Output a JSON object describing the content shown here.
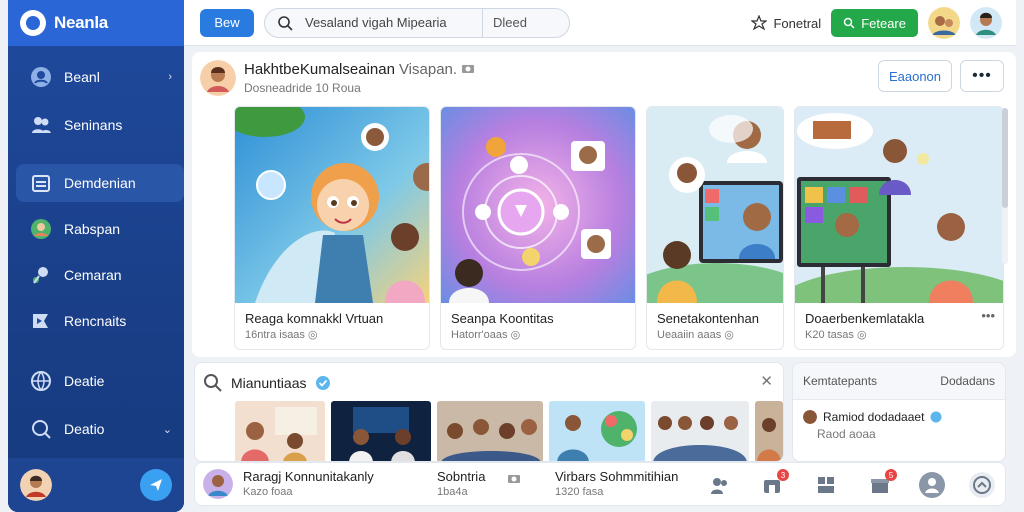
{
  "brand": {
    "name": "Neanla"
  },
  "sidebar": {
    "items": [
      {
        "label": "Beanl",
        "icon": "user-circle-icon",
        "caret": "›"
      },
      {
        "label": "Seninans",
        "icon": "people-icon"
      },
      {
        "label": "Demdenian",
        "icon": "calendar-icon",
        "active": true
      },
      {
        "label": "Rabspan",
        "icon": "avatar-icon"
      },
      {
        "label": "Cemaran",
        "icon": "search-person-icon"
      },
      {
        "label": "Rencnaits",
        "icon": "flag-icon"
      },
      {
        "label": "Deatie",
        "icon": "globe-icon"
      },
      {
        "label": "Deatio",
        "icon": "search-icon",
        "caret": "⌄"
      }
    ]
  },
  "topbar": {
    "new_label": "Bew",
    "search_placeholder": "Vesaland vigah Mipearia",
    "search_filter": "Dleed",
    "favorite_label": "Fonetral",
    "green_button_label": "Feteare"
  },
  "main": {
    "title": "HakhtbeKumalseainan",
    "title_muted": "Visapan.",
    "subtitle": "Dosneadride 10 Roua",
    "outline_button": "Eaaonon",
    "more_button": "•••",
    "cards": [
      {
        "caption": "Reaga komnakkl Vrtuan",
        "meta": "16ntra isaas"
      },
      {
        "caption": "Seanpa Koontitas",
        "meta": "Hatorr'oaas"
      },
      {
        "caption": "Senetakontenhan",
        "meta": "Ueaaiin aaas"
      },
      {
        "caption": "Doaerbenkemlatakla",
        "meta": "K20 tasas",
        "more": "•••"
      }
    ]
  },
  "community": {
    "title": "Mianuntiaas",
    "close": "✕"
  },
  "side_panel": {
    "tabs": [
      "Kemtatepants",
      "Dodadans"
    ],
    "row_title": "Ramiod dodadaaet",
    "row_meta": "Raod aoaa"
  },
  "bottombar": {
    "items": [
      {
        "title": "Raragj Konnunitakanly",
        "meta": "Kazo foaa"
      },
      {
        "title": "Sobntria",
        "meta": "1ba4a"
      },
      {
        "title": "Virbars Sohmmitihian",
        "meta": "1320 fasa"
      }
    ],
    "icons": [
      {
        "name": "people-icon",
        "badge": ""
      },
      {
        "name": "store-icon",
        "badge": "3"
      },
      {
        "name": "group-icon",
        "badge": ""
      },
      {
        "name": "gift-icon",
        "badge": "5"
      },
      {
        "name": "profile-icon",
        "badge": ""
      },
      {
        "name": "share-icon",
        "badge": ""
      }
    ]
  },
  "colors": {
    "brand": "#2a66d6",
    "sidebar": "#1a3f88",
    "green": "#23a84a",
    "accent": "#2a7be0"
  }
}
